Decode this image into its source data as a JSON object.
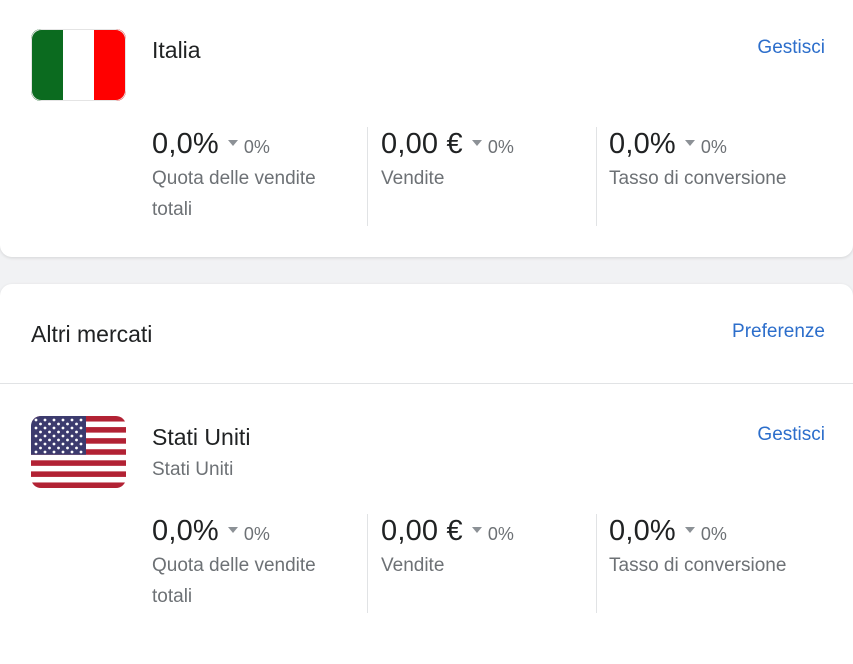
{
  "italy": {
    "flag": "italy-flag",
    "name": "Italia",
    "manage_label": "Gestisci",
    "metrics": [
      {
        "value": "0,0%",
        "change": "0%",
        "label": "Quota delle vendite totali"
      },
      {
        "value": "0,00 €",
        "change": "0%",
        "label": "Vendite"
      },
      {
        "value": "0,0%",
        "change": "0%",
        "label": "Tasso di conversione"
      }
    ]
  },
  "other_markets": {
    "title": "Altri mercati",
    "preferences_label": "Preferenze",
    "markets": [
      {
        "flag": "us-flag",
        "name": "Stati Uniti",
        "subtitle": "Stati Uniti",
        "manage_label": "Gestisci",
        "metrics": [
          {
            "value": "0,0%",
            "change": "0%",
            "label": "Quota delle vendite totali"
          },
          {
            "value": "0,00 €",
            "change": "0%",
            "label": "Vendite"
          },
          {
            "value": "0,0%",
            "change": "0%",
            "label": "Tasso di conversione"
          }
        ]
      }
    ]
  },
  "colors": {
    "link": "#2c6ecb",
    "text": "#202223",
    "subdued": "#6d7175",
    "background": "#f1f2f4"
  }
}
